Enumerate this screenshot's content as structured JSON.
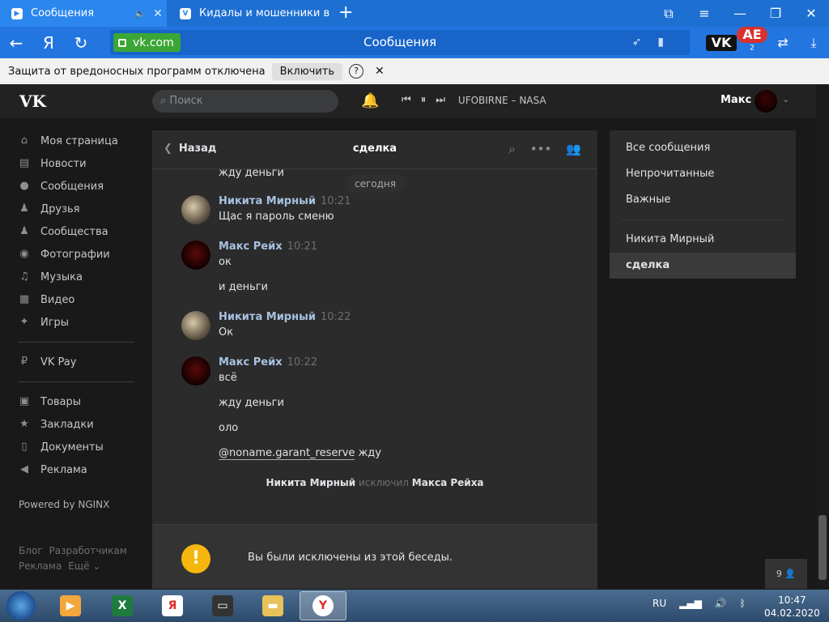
{
  "browser": {
    "tabs": [
      {
        "title": "Сообщения",
        "favicon": "vk-icon",
        "active": true
      },
      {
        "title": "Кидалы и мошенники в vk",
        "favicon": "vk-icon",
        "active": false
      }
    ],
    "url_domain": "vk.com",
    "page_title": "Сообщения",
    "protection_text": "Защита от вредоносных программ отключена",
    "protection_button": "Включить",
    "help_symbol": "?",
    "ext_vk": "VK",
    "ext_ae": "AE",
    "ext_ae_badge": "2"
  },
  "vk": {
    "logo": "VK",
    "search_placeholder": "Поиск",
    "track": "UFOBIRNE – NASA",
    "user_name": "Макс"
  },
  "nav": {
    "items": [
      {
        "label": "Моя страница",
        "icon": "home-icon"
      },
      {
        "label": "Новости",
        "icon": "news-icon"
      },
      {
        "label": "Сообщения",
        "icon": "messages-icon"
      },
      {
        "label": "Друзья",
        "icon": "friend-icon"
      },
      {
        "label": "Сообщества",
        "icon": "groups-icon"
      },
      {
        "label": "Фотографии",
        "icon": "camera-icon"
      },
      {
        "label": "Музыка",
        "icon": "music-icon"
      },
      {
        "label": "Видео",
        "icon": "video-icon"
      },
      {
        "label": "Игры",
        "icon": "games-icon"
      }
    ],
    "pay": "VK Pay",
    "items2": [
      {
        "label": "Товары",
        "icon": "bag-icon"
      },
      {
        "label": "Закладки",
        "icon": "star-icon"
      },
      {
        "label": "Документы",
        "icon": "document-icon"
      },
      {
        "label": "Реклама",
        "icon": "megaphone-icon"
      }
    ],
    "powered": "Powered by NGINX",
    "footer": [
      "Блог",
      "Разработчикам",
      "Реклама",
      "Ещё ⌄"
    ]
  },
  "chat": {
    "back_label": "Назад",
    "title": "сделка",
    "day_label": "сегодня",
    "top_message": "жду деньги",
    "messages": [
      {
        "name": "Никита Мирный",
        "time": "10:21",
        "lines": [
          "Щас я пароль сменю"
        ]
      },
      {
        "name": "Макс Рейх",
        "time": "10:21",
        "lines": [
          "ок",
          "и деньги"
        ]
      },
      {
        "name": "Никита Мирный",
        "time": "10:22",
        "lines": [
          "Ок"
        ]
      },
      {
        "name": "Макс Рейх",
        "time": "10:22",
        "lines": [
          "всё",
          "жду деньги",
          "оло"
        ]
      }
    ],
    "mention": "@noname.garant_reserve",
    "mention_suffix": " жду",
    "system": {
      "actor": "Никита Мирный",
      "action": " исключил ",
      "target": "Макса Рейха"
    },
    "kicked_text": "Вы были исключены из этой беседы."
  },
  "right_panel": {
    "items": [
      "Все сообщения",
      "Непрочитанные",
      "Важные"
    ],
    "items2": [
      "Никита Мирный",
      "сделка"
    ]
  },
  "counter": "9",
  "taskbar": {
    "lang": "RU",
    "time": "10:47",
    "date": "04.02.2020"
  }
}
